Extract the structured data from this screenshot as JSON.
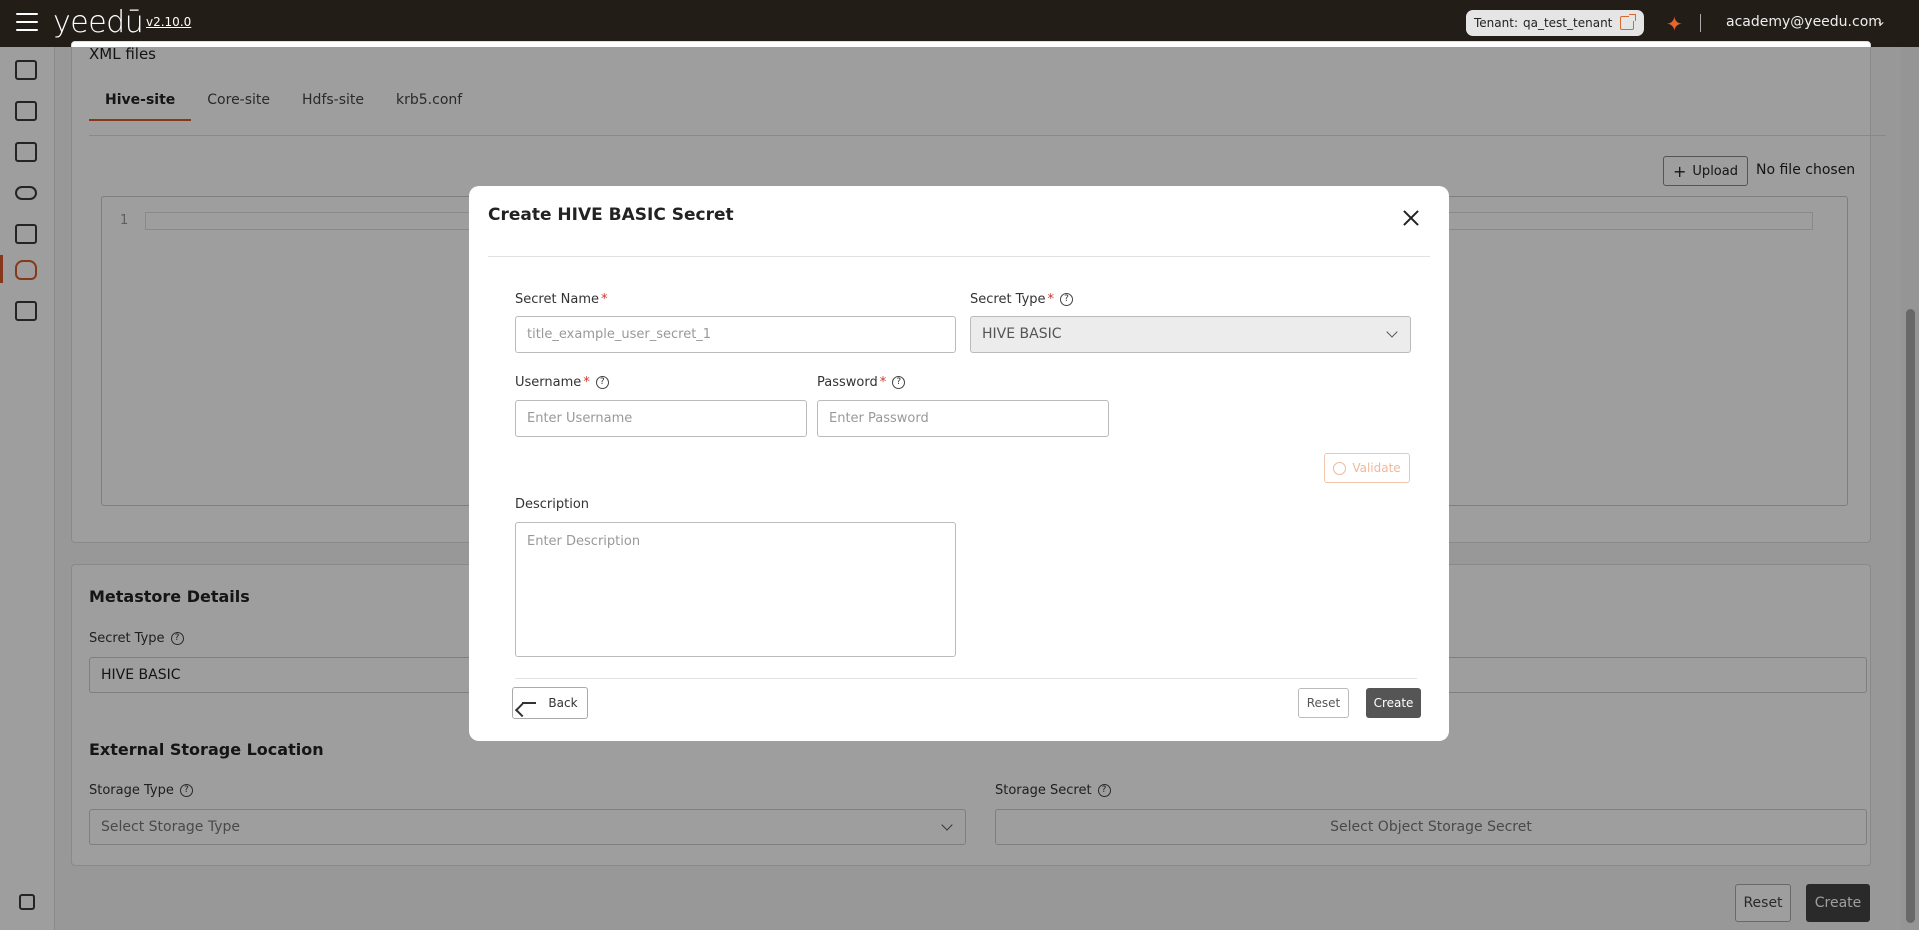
{
  "topbar": {
    "logo": "yeedū",
    "version": "v2.10.0",
    "tenant_label": "Tenant:",
    "tenant_value": "qa_test_tenant",
    "user_email": "academy@yeedu.com"
  },
  "sidebar": {
    "items": [
      "workspace",
      "clusters",
      "jobs",
      "secrets",
      "dashboards",
      "metastores",
      "reports",
      "docs"
    ],
    "active": "metastores"
  },
  "xml_files": {
    "title": "XML files",
    "tabs": [
      "Hive-site",
      "Core-site",
      "Hdfs-site",
      "krb5.conf"
    ],
    "active_tab": "Hive-site",
    "upload_label": "Upload",
    "no_file": "No file chosen",
    "line_number": "1"
  },
  "metastore": {
    "title": "Metastore Details",
    "secret_type_label": "Secret Type",
    "secret_type_value": "HIVE BASIC"
  },
  "storage": {
    "title": "External Storage Location",
    "storage_type_label": "Storage Type",
    "storage_type_placeholder": "Select Storage Type",
    "storage_secret_label": "Storage Secret",
    "storage_secret_placeholder": "Select Object Storage Secret"
  },
  "page_actions": {
    "reset": "Reset",
    "create": "Create"
  },
  "modal": {
    "title": "Create HIVE BASIC Secret",
    "secret_name_label": "Secret Name",
    "secret_name_placeholder": "title_example_user_secret_1",
    "secret_type_label": "Secret Type",
    "secret_type_value": "HIVE BASIC",
    "username_label": "Username",
    "username_placeholder": "Enter Username",
    "password_label": "Password",
    "password_placeholder": "Enter Password",
    "validate_label": "Validate",
    "description_label": "Description",
    "description_placeholder": "Enter Description",
    "back_label": "Back",
    "reset_label": "Reset",
    "create_label": "Create"
  },
  "colors": {
    "accent": "#d75b2b",
    "topbar": "#231d18"
  }
}
